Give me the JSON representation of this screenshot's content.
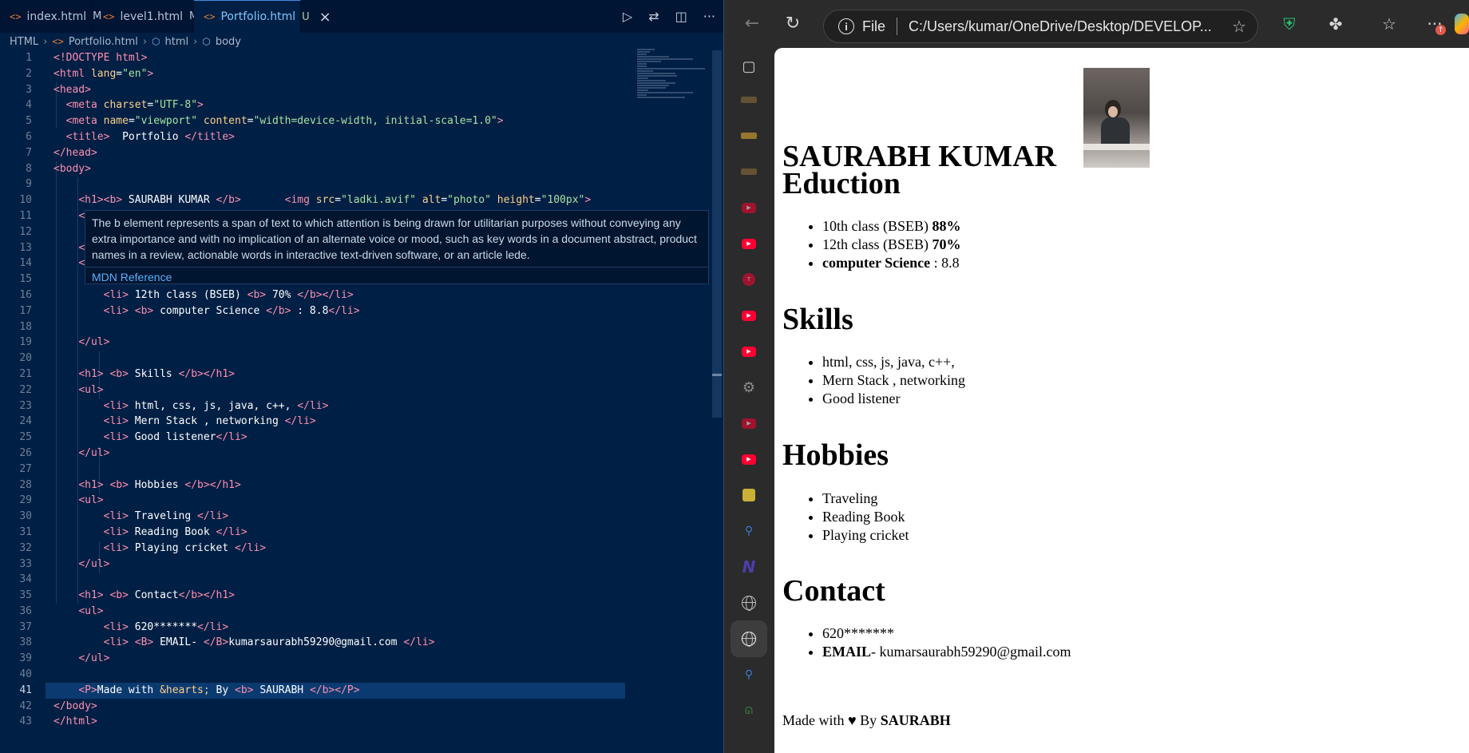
{
  "vscode": {
    "tabs": [
      {
        "icon": "<>",
        "label": "index.html",
        "status": "M"
      },
      {
        "icon": "<>",
        "label": "level1.html",
        "status": "M"
      },
      {
        "icon": "<>",
        "label": "Portfolio.html",
        "status": "U"
      }
    ],
    "breadcrumbs": [
      "HTML",
      "Portfolio.html",
      "html",
      "body"
    ],
    "line_numbers": [
      "1",
      "2",
      "3",
      "4",
      "5",
      "6",
      "7",
      "8",
      "9",
      "10",
      "11",
      "12",
      "13",
      "14",
      "15",
      "16",
      "17",
      "18",
      "19",
      "20",
      "21",
      "22",
      "23",
      "24",
      "25",
      "26",
      "27",
      "28",
      "29",
      "30",
      "31",
      "32",
      "33",
      "34",
      "35",
      "36",
      "37",
      "38",
      "39",
      "40",
      "41",
      "42",
      "43"
    ],
    "hover": {
      "text": "The b element represents a span of text to which attention is being drawn for utilitarian purposes without conveying any extra importance and with no implication of an alternate voice or mood, such as key words in a document abstract, product names in a review, actionable words in interactive text-driven software, or an article lede.",
      "link": "MDN Reference"
    }
  },
  "browser": {
    "address_file": "File",
    "url": "C:/Users/kumar/OneDrive/Desktop/DEVELOP...",
    "ext_badge": "↑"
  },
  "portfolio": {
    "title": "SAURABH KUMAR",
    "photo_alt": "photo",
    "sections": [
      {
        "heading": "Eduction",
        "items": [
          {
            "text": "10th class (BSEB) ",
            "bold": "88%",
            "bold_first": false
          },
          {
            "text": "12th class (BSEB) ",
            "bold": "70%",
            "bold_first": false
          },
          {
            "text": " : 8.8",
            "bold": "computer Science",
            "bold_first": true
          }
        ]
      },
      {
        "heading": "Skills",
        "items": [
          {
            "text": "html, css, js, java, c++,",
            "bold": "",
            "bold_first": false
          },
          {
            "text": "Mern Stack , networking",
            "bold": "",
            "bold_first": false
          },
          {
            "text": "Good listener",
            "bold": "",
            "bold_first": false
          }
        ]
      },
      {
        "heading": "Hobbies",
        "items": [
          {
            "text": "Traveling",
            "bold": "",
            "bold_first": false
          },
          {
            "text": "Reading Book",
            "bold": "",
            "bold_first": false
          },
          {
            "text": "Playing cricket",
            "bold": "",
            "bold_first": false
          }
        ]
      },
      {
        "heading": "Contact",
        "items": [
          {
            "text": "620*******",
            "bold": "",
            "bold_first": false
          },
          {
            "text": "- kumarsaurabh59290@gmail.com",
            "bold": "EMAIL",
            "bold_first": true
          }
        ]
      }
    ],
    "footer": {
      "pre": "Made with ",
      "heart": "♥",
      "mid": " By ",
      "bold": "SAURABH"
    }
  }
}
